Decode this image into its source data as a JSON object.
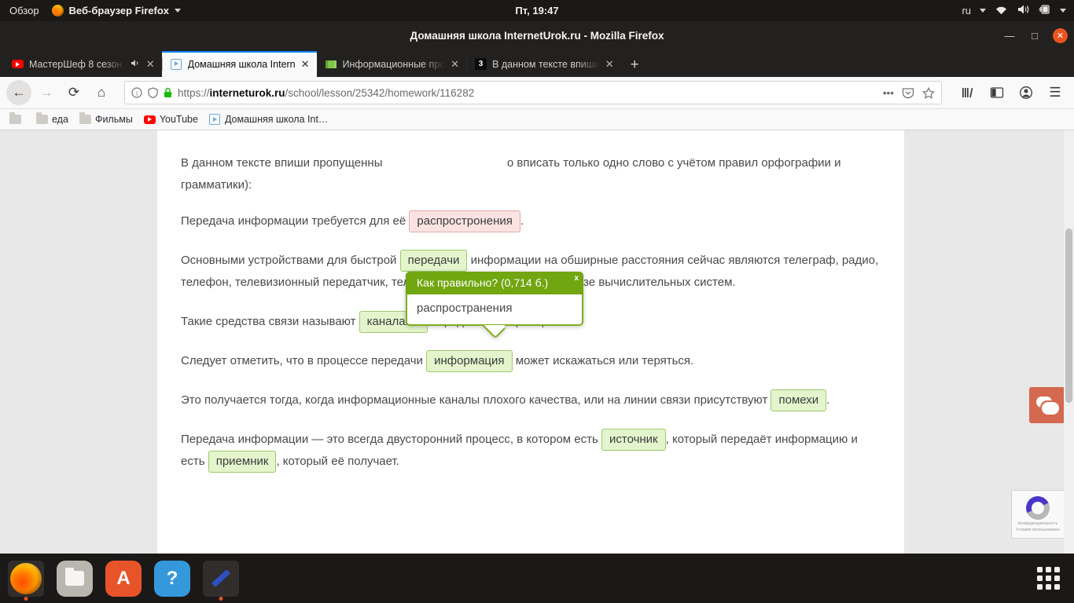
{
  "panel": {
    "overview_label": "Обзор",
    "app_label": "Веб-браузер Firefox",
    "clock": "Пт, 19:47",
    "keyboard_layout": "ru"
  },
  "window": {
    "title": "Домашняя школа InternetUrok.ru - Mozilla Firefox",
    "minimize": "—",
    "maximize": "□",
    "close": "✕"
  },
  "tabs": [
    {
      "label": "МастерШеф 8 сезон.",
      "favicon": "youtube-icon",
      "muted_icon": "sound-icon",
      "close": "✕",
      "active": false
    },
    {
      "label": "Домашняя школа Intern",
      "favicon": "video-play-icon",
      "close": "✕",
      "active": true
    },
    {
      "label": "Информационные про",
      "favicon": "green-book-icon",
      "close": "✕",
      "active": false
    },
    {
      "label": "В данном тексте впиши",
      "favicon": "badge-3-icon",
      "badge": "3",
      "close": "✕",
      "active": false
    }
  ],
  "newtab_label": "+",
  "nav": {
    "back": "←",
    "forward": "→",
    "reload": "⟳",
    "home": "⌂",
    "url_prefix": "https://",
    "url_domain": "interneturok.ru",
    "url_path": "/school/lesson/25342/homework/116282",
    "url_full": "https://interneturok.ru/school/lesson/25342/homework/116282",
    "page_actions": "•••",
    "pocket": "pocket-icon",
    "bookmark_star": "☆",
    "library": "library-icon",
    "sidebar": "sidebar-icon",
    "account": "account-icon",
    "menu": "☰"
  },
  "bookmarks": [
    {
      "label": "",
      "icon": "folder-icon"
    },
    {
      "label": "еда",
      "icon": "folder-icon"
    },
    {
      "label": "Фильмы",
      "icon": "folder-icon"
    },
    {
      "label": "YouTube",
      "icon": "youtube-icon"
    },
    {
      "label": "Домашняя школа Int…",
      "icon": "video-play-icon"
    }
  ],
  "tooltip": {
    "header": "Как правильно? (0,714 б.)",
    "close": "x",
    "answer": "распространения"
  },
  "lesson": {
    "intro_1": "В данном тексте впиши пропущенны",
    "intro_2": "о вписать только одно слово с учётом правил орфографии и грамматики):",
    "p1_before": "Передача информации требуется для её",
    "p1_blank": "распростронения",
    "p1_after": ".",
    "p2_before": "Основными устройствами для быстрой",
    "p2_blank": "передачи",
    "p2_after": "информации на обширные расстояния сейчас являются телеграф, радио, телефон, телевизионный передатчик, телекоммуникационные сети на базе вычислительных систем.",
    "p3_before": "Такие средства связи называют",
    "p3_blank": "каналами",
    "p3_after": "передачи информации.",
    "p4_before": "Следует отметить, что в процессе передачи",
    "p4_blank": "информация",
    "p4_after": "может искажаться или теряться.",
    "p5_before": "Это получается  тогда, когда информационные каналы плохого качества, или на линии связи присутствуют",
    "p5_blank": "помехи",
    "p5_after": ".",
    "p6_before": "Передача информации — это всегда двусторонний процесс, в котором есть",
    "p6_blank1": "источник",
    "p6_mid": ", который передаёт информацию и есть",
    "p6_blank2": "приемник",
    "p6_after": ", который её получает."
  },
  "widgets": {
    "chat_label": "chat-bubble-icon",
    "recaptcha_line1": "Конфиденциальность",
    "recaptcha_line2": "Условия использования"
  },
  "dock": [
    {
      "name": "firefox",
      "label": "Firefox"
    },
    {
      "name": "files",
      "label": "Файлы"
    },
    {
      "name": "amazon",
      "label": "A"
    },
    {
      "name": "help",
      "label": "?"
    },
    {
      "name": "text-editor",
      "label": "Текстовый редактор"
    }
  ],
  "colors": {
    "accent_green": "#71a611",
    "blank_ok_bg": "#e4f5cd",
    "blank_bad_bg": "#fbe3e3",
    "ubuntu_orange": "#e95420",
    "chat_widget": "#d4694f"
  }
}
